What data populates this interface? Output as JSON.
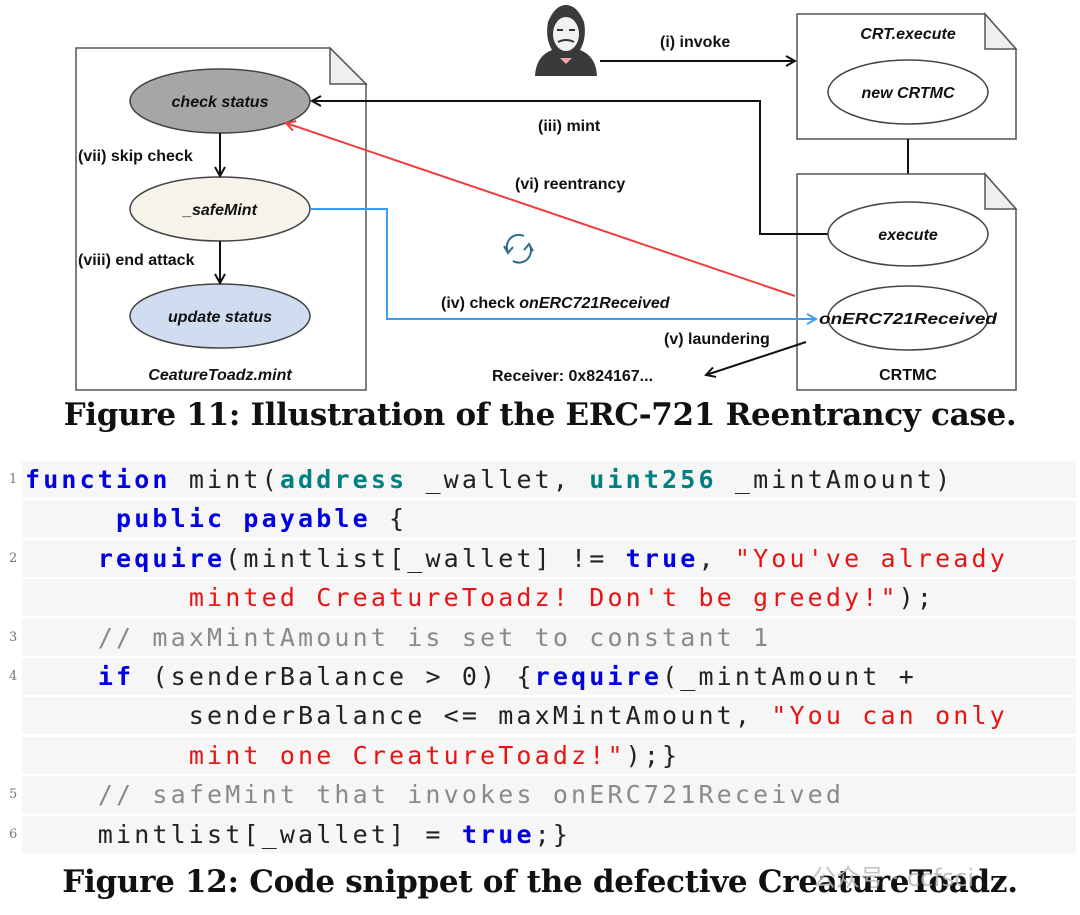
{
  "figure11": {
    "caption": "Figure 11: Illustration of the ERC-721 Reentrancy case.",
    "left_doc": {
      "title": "CeatureToadz.mint",
      "nodes": [
        "check status",
        "_safeMint",
        "update status"
      ],
      "edges": [
        "(vii) skip check",
        "(viii) end attack"
      ]
    },
    "crt_doc": {
      "title": "CRT.execute",
      "node": "new CRTMC"
    },
    "crtmc_doc": {
      "title": "CRTMC",
      "nodes": [
        "execute",
        "onERC721Received"
      ]
    },
    "labels": {
      "invoke": "(i) invoke",
      "mint": "(iii) mint",
      "reentrancy": "(vi) reentrancy",
      "check_prefix": "(iv) check ",
      "check_fn": "onERC721Received",
      "laundering": "(v) laundering",
      "receiver": "Receiver: 0x824167..."
    },
    "icons": {
      "attacker": "hacker-mask-icon",
      "loop": "refresh-icon"
    },
    "colors": {
      "check_status": "#a6a6a6",
      "safemint": "#f5f3ea",
      "update_status": "#d0dcef",
      "reentrancy_arrow": "#f03c3c",
      "check_arrow": "#3d9ef0",
      "loop_icon": "#2e6b8a"
    }
  },
  "figure12": {
    "caption": "Figure 12: Code snippet of the defective CreatureToadz.",
    "rows": [
      {
        "n": "1",
        "tokens": [
          {
            "t": "function",
            "c": "kw"
          },
          {
            "t": " mint(",
            "c": "pl"
          },
          {
            "t": "address",
            "c": "ty"
          },
          {
            "t": " _wallet, ",
            "c": "pl"
          },
          {
            "t": "uint256",
            "c": "ty"
          },
          {
            "t": " _mintAmount)",
            "c": "pl"
          }
        ]
      },
      {
        "n": "",
        "tokens": [
          {
            "t": "     ",
            "c": "pl"
          },
          {
            "t": "public payable",
            "c": "kw"
          },
          {
            "t": " {",
            "c": "pl"
          }
        ]
      },
      {
        "n": "2",
        "tokens": [
          {
            "t": "    ",
            "c": "pl"
          },
          {
            "t": "require",
            "c": "kw"
          },
          {
            "t": "(mintlist[_wallet] != ",
            "c": "pl"
          },
          {
            "t": "true",
            "c": "kw"
          },
          {
            "t": ", ",
            "c": "pl"
          },
          {
            "t": "\"You've already",
            "c": "st"
          }
        ]
      },
      {
        "n": "",
        "tokens": [
          {
            "t": "         ",
            "c": "pl"
          },
          {
            "t": "minted CreatureToadz! Don't be greedy!\"",
            "c": "st"
          },
          {
            "t": ");",
            "c": "pl"
          }
        ]
      },
      {
        "n": "3",
        "tokens": [
          {
            "t": "    ",
            "c": "pl"
          },
          {
            "t": "// maxMintAmount is set to constant 1",
            "c": "cm"
          }
        ]
      },
      {
        "n": "4",
        "tokens": [
          {
            "t": "    ",
            "c": "pl"
          },
          {
            "t": "if",
            "c": "kw"
          },
          {
            "t": " (senderBalance > 0) {",
            "c": "pl"
          },
          {
            "t": "require",
            "c": "kw"
          },
          {
            "t": "(_mintAmount +",
            "c": "pl"
          }
        ]
      },
      {
        "n": "",
        "tokens": [
          {
            "t": "         senderBalance <= maxMintAmount, ",
            "c": "pl"
          },
          {
            "t": "\"You can only",
            "c": "st"
          }
        ]
      },
      {
        "n": "",
        "tokens": [
          {
            "t": "         ",
            "c": "pl"
          },
          {
            "t": "mint one CreatureToadz!\"",
            "c": "st"
          },
          {
            "t": ");}",
            "c": "pl"
          }
        ]
      },
      {
        "n": "5",
        "tokens": [
          {
            "t": "    ",
            "c": "pl"
          },
          {
            "t": "// safeMint that invokes onERC721Received",
            "c": "cm"
          }
        ]
      },
      {
        "n": "6",
        "tokens": [
          {
            "t": "    mintlist[_wallet] = ",
            "c": "pl"
          },
          {
            "t": "true",
            "c": "kw"
          },
          {
            "t": ";}",
            "c": "pl"
          }
        ]
      }
    ]
  },
  "watermark": "公众号 · ccfsci"
}
